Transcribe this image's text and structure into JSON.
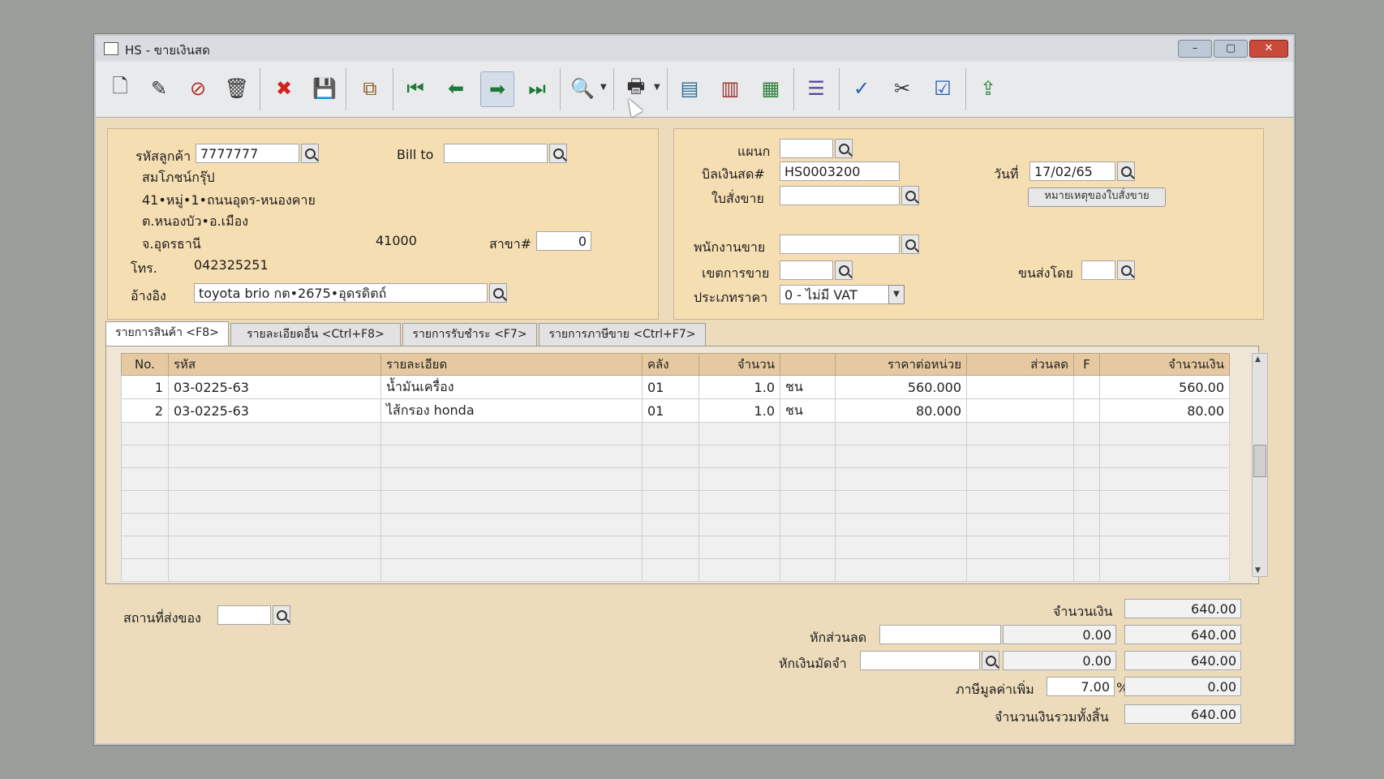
{
  "window": {
    "title": "HS - ขายเงินสด",
    "controls": {
      "minimize": "–",
      "maximize": "▢",
      "close": "✕"
    }
  },
  "toolbar": {
    "buttons": [
      {
        "icon": "new-document-icon",
        "glyph": "🗋"
      },
      {
        "icon": "edit-icon",
        "glyph": "✎"
      },
      {
        "icon": "void-icon",
        "glyph": "⊘"
      },
      {
        "icon": "trash-icon",
        "glyph": "🗑"
      },
      {
        "icon": "cancel-icon",
        "glyph": "✖"
      },
      {
        "icon": "save-icon",
        "glyph": "💾"
      },
      {
        "icon": "copy-icon",
        "glyph": "⧉"
      },
      {
        "icon": "first-record-icon",
        "glyph": "⏮"
      },
      {
        "icon": "previous-record-icon",
        "glyph": "⬅"
      },
      {
        "icon": "next-record-icon",
        "glyph": "➡"
      },
      {
        "icon": "last-record-icon",
        "glyph": "⏭"
      },
      {
        "icon": "find-icon",
        "glyph": "🔍"
      },
      {
        "icon": "print-icon",
        "glyph": "🖶"
      },
      {
        "icon": "form-icon",
        "glyph": "▤"
      },
      {
        "icon": "report-icon",
        "glyph": "▥"
      },
      {
        "icon": "sheet-icon",
        "glyph": "▦"
      },
      {
        "icon": "list-icon",
        "glyph": "☰"
      },
      {
        "icon": "approve-icon",
        "glyph": "✓"
      },
      {
        "icon": "cut-icon",
        "glyph": "✂"
      },
      {
        "icon": "ok-icon",
        "glyph": "☑"
      },
      {
        "icon": "export-icon",
        "glyph": "⇪"
      }
    ]
  },
  "customer": {
    "code_label": "รหัสลูกค้า",
    "code": "7777777",
    "bill_to_label": "Bill to",
    "bill_to": "",
    "name": "สมโภชน์กรุ๊ป",
    "address1": "41•หมู่•1•ถนนอุดร-หนองคาย",
    "address2": "ต.หนองบัว•อ.เมือง",
    "province": "จ.อุดรธานี",
    "postcode": "41000",
    "branch_label": "สาขา#",
    "branch": "0",
    "phone_label": "โทร.",
    "phone": "042325251",
    "ref_label": "อ้างอิง",
    "ref": "toyota brio กต•2675•อุดรดิตถ์"
  },
  "doc": {
    "dept_label": "แผนก",
    "dept": "",
    "bill_no_label": "บิลเงินสด#",
    "bill_no": "HS0003200",
    "date_label": "วันที่",
    "date": "17/02/65",
    "so_label": "ใบสั่งขาย",
    "so": "",
    "so_note_button": "หมายเหตุของใบสั่งขาย",
    "salesman_label": "พนักงานขาย",
    "salesman": "",
    "zone_label": "เขตการขาย",
    "zone": "",
    "ship_by_label": "ขนส่งโดย",
    "ship_by": "",
    "price_type_label": "ประเภทราคา",
    "price_type": "0 - ไม่มี VAT"
  },
  "tabs": [
    {
      "label": "รายการสินค้า <F8>",
      "selected": true
    },
    {
      "label": "รายละเอียดอื่น <Ctrl+F8>",
      "selected": false
    },
    {
      "label": "รายการรับชำระ <F7>",
      "selected": false
    },
    {
      "label": "รายการภาษีขาย <Ctrl+F7>",
      "selected": false
    }
  ],
  "grid": {
    "headers": [
      "No.",
      "รหัส",
      "รายละเอียด",
      "คลัง",
      "จำนวน",
      "",
      "ราคาต่อหน่วย",
      "ส่วนลด",
      "F",
      "จำนวนเงิน"
    ],
    "rows": [
      {
        "no": "1",
        "code": "03-0225-63",
        "desc": "น้ำมันเครื่อง",
        "wh": "01",
        "qty": "1.0",
        "unit": "ชน",
        "price": "560.000",
        "disc": "",
        "f": "",
        "amount": "560.00"
      },
      {
        "no": "2",
        "code": "03-0225-63",
        "desc": "ไส้กรอง honda",
        "wh": "01",
        "qty": "1.0",
        "unit": "ชน",
        "price": "80.000",
        "disc": "",
        "f": "",
        "amount": "80.00"
      }
    ]
  },
  "footer": {
    "ship_place_label": "สถานที่ส่งของ",
    "ship_place": "",
    "amount_label": "จำนวนเงิน",
    "amount": "640.00",
    "discount_label": "หักส่วนลด",
    "discount_text": "",
    "discount_value": "0.00",
    "after_discount": "640.00",
    "deposit_label": "หักเงินมัดจำ",
    "deposit_text": "",
    "deposit_value": "0.00",
    "after_deposit": "640.00",
    "vat_label": "ภาษีมูลค่าเพิ่ม",
    "vat_rate": "7.00",
    "vat_pct": "%",
    "vat_amount": "0.00",
    "total_label": "จำนวนเงินรวมทั้งสิ้น",
    "total": "640.00"
  }
}
